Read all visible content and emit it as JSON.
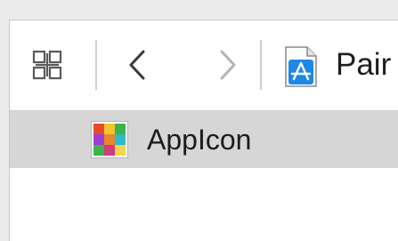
{
  "jumpbar": {
    "grid_icon": "related-items-grid-icon",
    "back_icon": "chevron-left-icon",
    "forward_icon": "chevron-right-icon",
    "file_icon": "app-store-document-icon",
    "breadcrumb_label": "Pair"
  },
  "asset_list": {
    "items": [
      {
        "icon": "app-icon-thumbnail",
        "label": "AppIcon",
        "selected": true
      }
    ]
  },
  "colors": {
    "selection_bg": "#d6d6d6",
    "chrome_bg": "#ececec",
    "file_icon_blue": "#1e88e5"
  }
}
